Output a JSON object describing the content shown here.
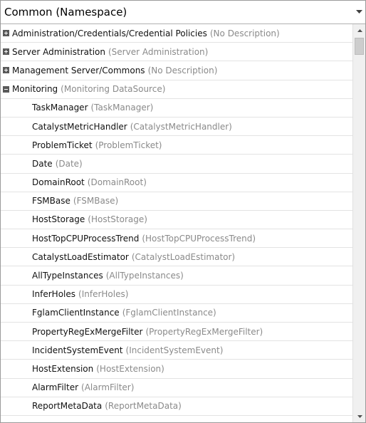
{
  "combo": {
    "value": "Common (Namespace)",
    "arrow_icon": "caret-down-icon"
  },
  "groups": [
    {
      "name": "Administration/Credentials/Credential Policies",
      "desc": "(No Description)",
      "state": "collapsed"
    },
    {
      "name": "Server Administration",
      "desc": "(Server Administration)",
      "state": "collapsed"
    },
    {
      "name": "Management Server/Commons",
      "desc": "(No Description)",
      "state": "collapsed"
    },
    {
      "name": "Monitoring",
      "desc": "(Monitoring DataSource)",
      "state": "expanded"
    }
  ],
  "children": [
    {
      "name": "TaskManager",
      "desc": "(TaskManager)"
    },
    {
      "name": "CatalystMetricHandler",
      "desc": "(CatalystMetricHandler)"
    },
    {
      "name": "ProblemTicket",
      "desc": "(ProblemTicket)"
    },
    {
      "name": "Date",
      "desc": "(Date)"
    },
    {
      "name": "DomainRoot",
      "desc": "(DomainRoot)"
    },
    {
      "name": "FSMBase",
      "desc": "(FSMBase)"
    },
    {
      "name": "HostStorage",
      "desc": "(HostStorage)"
    },
    {
      "name": "HostTopCPUProcessTrend",
      "desc": "(HostTopCPUProcessTrend)"
    },
    {
      "name": "CatalystLoadEstimator",
      "desc": "(CatalystLoadEstimator)"
    },
    {
      "name": "AllTypeInstances",
      "desc": "(AllTypeInstances)"
    },
    {
      "name": "InferHoles",
      "desc": "(InferHoles)"
    },
    {
      "name": "FglamClientInstance",
      "desc": "(FglamClientInstance)"
    },
    {
      "name": "PropertyRegExMergeFilter",
      "desc": "(PropertyRegExMergeFilter)"
    },
    {
      "name": "IncidentSystemEvent",
      "desc": "(IncidentSystemEvent)"
    },
    {
      "name": "HostExtension",
      "desc": "(HostExtension)"
    },
    {
      "name": "AlarmFilter",
      "desc": "(AlarmFilter)"
    },
    {
      "name": "ReportMetaData",
      "desc": "(ReportMetaData)"
    }
  ],
  "scrollbar": {
    "up_icon": "scroll-up-icon",
    "down_icon": "scroll-down-icon"
  }
}
